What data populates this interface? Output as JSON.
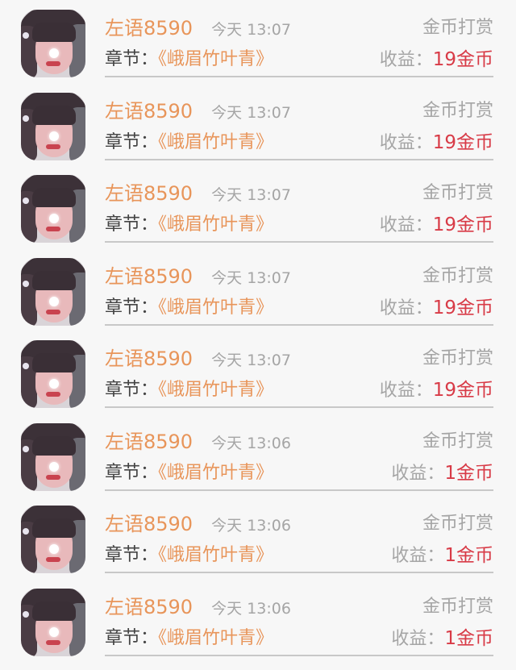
{
  "rewards": [
    {
      "user": "左语8590",
      "time": "今天 13:07",
      "type": "金币打赏",
      "chapter_label": "章节：",
      "chapter": "《峨眉竹叶青》",
      "earn_label": "收益：",
      "earn_value": "19金币"
    },
    {
      "user": "左语8590",
      "time": "今天 13:07",
      "type": "金币打赏",
      "chapter_label": "章节：",
      "chapter": "《峨眉竹叶青》",
      "earn_label": "收益：",
      "earn_value": "19金币"
    },
    {
      "user": "左语8590",
      "time": "今天 13:07",
      "type": "金币打赏",
      "chapter_label": "章节：",
      "chapter": "《峨眉竹叶青》",
      "earn_label": "收益：",
      "earn_value": "19金币"
    },
    {
      "user": "左语8590",
      "time": "今天 13:07",
      "type": "金币打赏",
      "chapter_label": "章节：",
      "chapter": "《峨眉竹叶青》",
      "earn_label": "收益：",
      "earn_value": "19金币"
    },
    {
      "user": "左语8590",
      "time": "今天 13:07",
      "type": "金币打赏",
      "chapter_label": "章节：",
      "chapter": "《峨眉竹叶青》",
      "earn_label": "收益：",
      "earn_value": "19金币"
    },
    {
      "user": "左语8590",
      "time": "今天 13:06",
      "type": "金币打赏",
      "chapter_label": "章节：",
      "chapter": "《峨眉竹叶青》",
      "earn_label": "收益：",
      "earn_value": "1金币"
    },
    {
      "user": "左语8590",
      "time": "今天 13:06",
      "type": "金币打赏",
      "chapter_label": "章节：",
      "chapter": "《峨眉竹叶青》",
      "earn_label": "收益：",
      "earn_value": "1金币"
    },
    {
      "user": "左语8590",
      "time": "今天 13:06",
      "type": "金币打赏",
      "chapter_label": "章节：",
      "chapter": "《峨眉竹叶青》",
      "earn_label": "收益：",
      "earn_value": "1金币"
    }
  ]
}
